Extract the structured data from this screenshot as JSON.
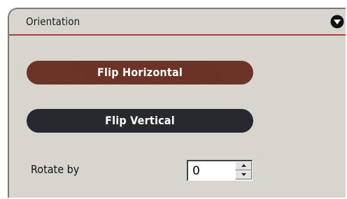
{
  "panel": {
    "title": "Orientation",
    "collapse_icon": "chevron-down-circle-icon"
  },
  "buttons": {
    "flip_horizontal": "Flip Horizontal",
    "flip_vertical": "Flip Vertical"
  },
  "rotate": {
    "label": "Rotate by",
    "value": "0",
    "up_icon": "spin-up-icon",
    "down_icon": "spin-down-icon"
  },
  "colors": {
    "panel_bg": "#d8d5cf",
    "header_rule": "#a5483a",
    "flip_horizontal_bg": "#6b3024",
    "flip_vertical_bg": "#28292e"
  }
}
